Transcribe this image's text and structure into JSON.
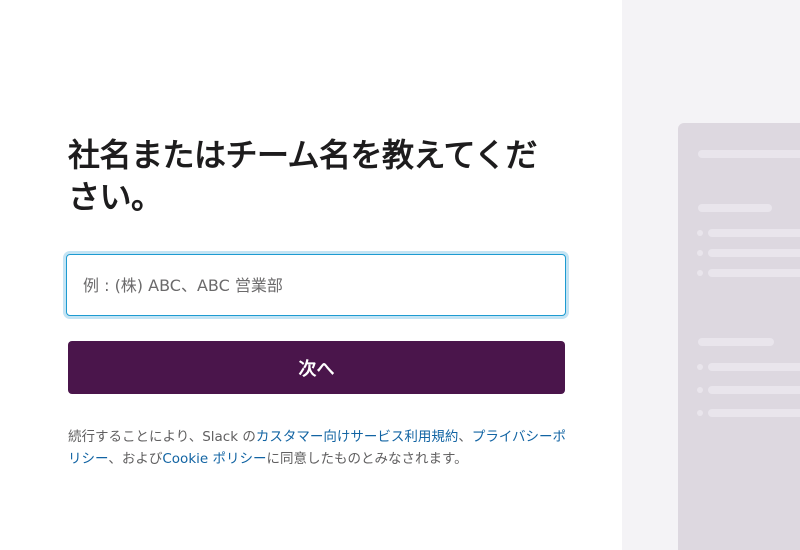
{
  "signup": {
    "heading": "社名またはチーム名を教えてください。",
    "team_name_placeholder": "例 : (株) ABC、ABC 営業部",
    "team_name_value": "",
    "next_label": "次へ",
    "terms": {
      "prefix": "続行することにより、Slack の",
      "customer_terms_link": "カスタマー向けサービス利用規約",
      "separator": "、",
      "privacy_policy_link": "プライバシーポリシー",
      "and_text": "、および",
      "cookie_policy_link": "Cookie ポリシー",
      "suffix": "に同意したものとみなされます。"
    }
  },
  "theme": {
    "primary_button": "#4a154b",
    "link": "#1264a3",
    "input_focus_border": "#1d9bd1",
    "preview_background": "#f4f3f6",
    "preview_card": "#ddd8e0"
  }
}
